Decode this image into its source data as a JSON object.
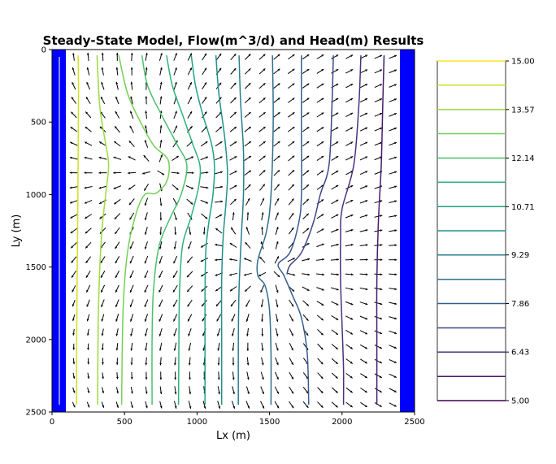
{
  "chart_data": {
    "type": "contour",
    "title": "Steady-State Model, Flow(m^3/d) and Head(m) Results",
    "xlabel": "Lx (m)",
    "ylabel": "Ly (m)",
    "xlim": [
      0,
      2500
    ],
    "ylim": [
      2500,
      0
    ],
    "x_ticks": [
      0,
      500,
      1000,
      1500,
      2000,
      2500
    ],
    "y_ticks": [
      0,
      500,
      1000,
      1500,
      2000,
      2500
    ],
    "boundary_color": "#0000ff",
    "colorbar": {
      "ticks": [
        "15.00",
        "13.57",
        "12.14",
        "10.71",
        "9.29",
        "7.86",
        "6.43",
        "5.00"
      ],
      "levels": [
        15.0,
        14.29,
        13.57,
        12.86,
        12.14,
        11.43,
        10.71,
        10.0,
        9.29,
        8.57,
        7.86,
        7.14,
        6.43,
        5.71,
        5.0
      ],
      "colors": [
        "#fde725",
        "#d0e11c",
        "#a0da39",
        "#73d056",
        "#4ac16d",
        "#2db27d",
        "#1fa187",
        "#21918c",
        "#277f8e",
        "#2e6e8e",
        "#365c8d",
        "#3f4788",
        "#46327e",
        "#481b6d",
        "#440154"
      ]
    },
    "contours": [
      {
        "level": 14.29,
        "points": [
          [
            180,
            40
          ],
          [
            183,
            300
          ],
          [
            180,
            800
          ],
          [
            175,
            1400
          ],
          [
            170,
            2000
          ],
          [
            170,
            2450
          ]
        ]
      },
      {
        "level": 13.57,
        "points": [
          [
            310,
            40
          ],
          [
            330,
            400
          ],
          [
            370,
            650
          ],
          [
            390,
            800
          ],
          [
            370,
            1000
          ],
          [
            340,
            1300
          ],
          [
            320,
            1800
          ],
          [
            315,
            2450
          ]
        ]
      },
      {
        "level": 12.86,
        "points": [
          [
            460,
            40
          ],
          [
            520,
            300
          ],
          [
            600,
            480
          ],
          [
            700,
            660
          ],
          [
            800,
            760
          ],
          [
            795,
            900
          ],
          [
            720,
            990
          ],
          [
            640,
            1000
          ],
          [
            580,
            1130
          ],
          [
            520,
            1400
          ],
          [
            490,
            1800
          ],
          [
            480,
            2450
          ]
        ]
      },
      {
        "level": 12.14,
        "points": [
          [
            620,
            40
          ],
          [
            660,
            250
          ],
          [
            760,
            460
          ],
          [
            860,
            650
          ],
          [
            930,
            800
          ],
          [
            890,
            1000
          ],
          [
            820,
            1150
          ],
          [
            740,
            1350
          ],
          [
            700,
            1650
          ],
          [
            690,
            2000
          ],
          [
            690,
            2450
          ]
        ]
      },
      {
        "level": 11.43,
        "points": [
          [
            790,
            40
          ],
          [
            830,
            250
          ],
          [
            900,
            450
          ],
          [
            970,
            650
          ],
          [
            1020,
            800
          ],
          [
            1010,
            950
          ],
          [
            960,
            1150
          ],
          [
            900,
            1350
          ],
          [
            880,
            1650
          ],
          [
            875,
            2000
          ],
          [
            872,
            2450
          ]
        ]
      },
      {
        "level": 10.71,
        "points": [
          [
            960,
            40
          ],
          [
            990,
            250
          ],
          [
            1040,
            450
          ],
          [
            1100,
            650
          ],
          [
            1120,
            800
          ],
          [
            1110,
            1000
          ],
          [
            1080,
            1200
          ],
          [
            1060,
            1400
          ],
          [
            1055,
            1700
          ],
          [
            1055,
            2000
          ],
          [
            1055,
            2450
          ]
        ]
      },
      {
        "level": 10.0,
        "points": [
          [
            1130,
            40
          ],
          [
            1150,
            300
          ],
          [
            1190,
            600
          ],
          [
            1210,
            850
          ],
          [
            1200,
            1050
          ],
          [
            1180,
            1300
          ],
          [
            1170,
            1600
          ],
          [
            1170,
            2000
          ],
          [
            1170,
            2450
          ]
        ]
      },
      {
        "level": 9.29,
        "points": [
          [
            1290,
            40
          ],
          [
            1300,
            350
          ],
          [
            1320,
            700
          ],
          [
            1320,
            1000
          ],
          [
            1305,
            1300
          ],
          [
            1290,
            1650
          ],
          [
            1285,
            2000
          ],
          [
            1285,
            2450
          ]
        ]
      },
      {
        "level": 8.57,
        "points": [
          [
            1520,
            40
          ],
          [
            1525,
            500
          ],
          [
            1510,
            1000
          ],
          [
            1480,
            1250
          ],
          [
            1420,
            1450
          ],
          [
            1420,
            1560
          ],
          [
            1470,
            1630
          ],
          [
            1500,
            1800
          ],
          [
            1510,
            2100
          ],
          [
            1510,
            2450
          ]
        ]
      },
      {
        "level": 7.86,
        "points": [
          [
            1720,
            40
          ],
          [
            1720,
            500
          ],
          [
            1720,
            1000
          ],
          [
            1700,
            1200
          ],
          [
            1640,
            1400
          ],
          [
            1560,
            1480
          ],
          [
            1600,
            1560
          ],
          [
            1660,
            1700
          ],
          [
            1720,
            1850
          ],
          [
            1760,
            2100
          ],
          [
            1770,
            2450
          ]
        ]
      },
      {
        "level": 7.14,
        "points": [
          [
            1940,
            40
          ],
          [
            1930,
            400
          ],
          [
            1910,
            800
          ],
          [
            1850,
            1000
          ],
          [
            1800,
            1200
          ],
          [
            1720,
            1400
          ],
          [
            1640,
            1490
          ],
          [
            1620,
            1550
          ]
        ]
      },
      {
        "level": 6.43,
        "points": [
          [
            2130,
            40
          ],
          [
            2115,
            400
          ],
          [
            2080,
            800
          ],
          [
            2000,
            1100
          ],
          [
            1990,
            1300
          ],
          [
            1990,
            1600
          ],
          [
            2000,
            1900
          ],
          [
            2010,
            2200
          ],
          [
            2010,
            2450
          ]
        ]
      },
      {
        "level": 5.71,
        "points": [
          [
            2290,
            40
          ],
          [
            2280,
            400
          ],
          [
            2270,
            800
          ],
          [
            2250,
            1200
          ],
          [
            2240,
            1600
          ],
          [
            2240,
            2000
          ],
          [
            2240,
            2450
          ]
        ]
      }
    ],
    "flow_field": {
      "type": "quiver",
      "grid_x_start": 50,
      "grid_x_step": 100,
      "grid_y_start": 50,
      "grid_y_step": 100,
      "dominant_direction": "+x",
      "sources_near": [
        [
          720,
          830
        ],
        [
          1520,
          1520
        ]
      ]
    }
  }
}
